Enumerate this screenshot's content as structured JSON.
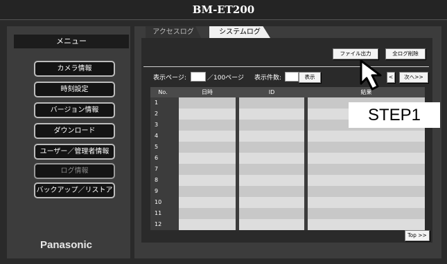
{
  "window": {
    "title": "BM-ET200"
  },
  "sidebar": {
    "header": "メニュー",
    "items": [
      {
        "label": "カメラ情報"
      },
      {
        "label": "時刻設定"
      },
      {
        "label": "バージョン情報"
      },
      {
        "label": "ダウンロード"
      },
      {
        "label": "ユーザー／管理者情報"
      },
      {
        "label": "ログ情報"
      },
      {
        "label": "バックアップ／リストア"
      }
    ],
    "brand": "Panasonic"
  },
  "tabs": [
    {
      "label": "アクセスログ",
      "selected": false
    },
    {
      "label": "システムログ",
      "selected": true
    }
  ],
  "toolbar": {
    "export_label": "ファイル出力",
    "delete_all_label": "全ログ削除"
  },
  "pagination": {
    "page_label": "表示ページ:",
    "page_value": "",
    "total_pages_label": "／100ページ",
    "count_label": "表示件数:",
    "count_value": "",
    "show_label": "表示",
    "prev_label": "<",
    "next_label": "次へ>>"
  },
  "table": {
    "columns": [
      "No.",
      "日時",
      "ID",
      "結果"
    ],
    "rows": [
      "1",
      "2",
      "3",
      "4",
      "5",
      "6",
      "7",
      "8",
      "9",
      "10",
      "11",
      "12"
    ]
  },
  "top_button": "Top >>",
  "annotation": {
    "step": "STEP1"
  },
  "colors": {
    "frame": "#2a2a2a",
    "panel": "#3c3c3c",
    "row_odd": "#c8c8c8",
    "row_even": "#dddddd",
    "button": "#f4f4f4"
  }
}
